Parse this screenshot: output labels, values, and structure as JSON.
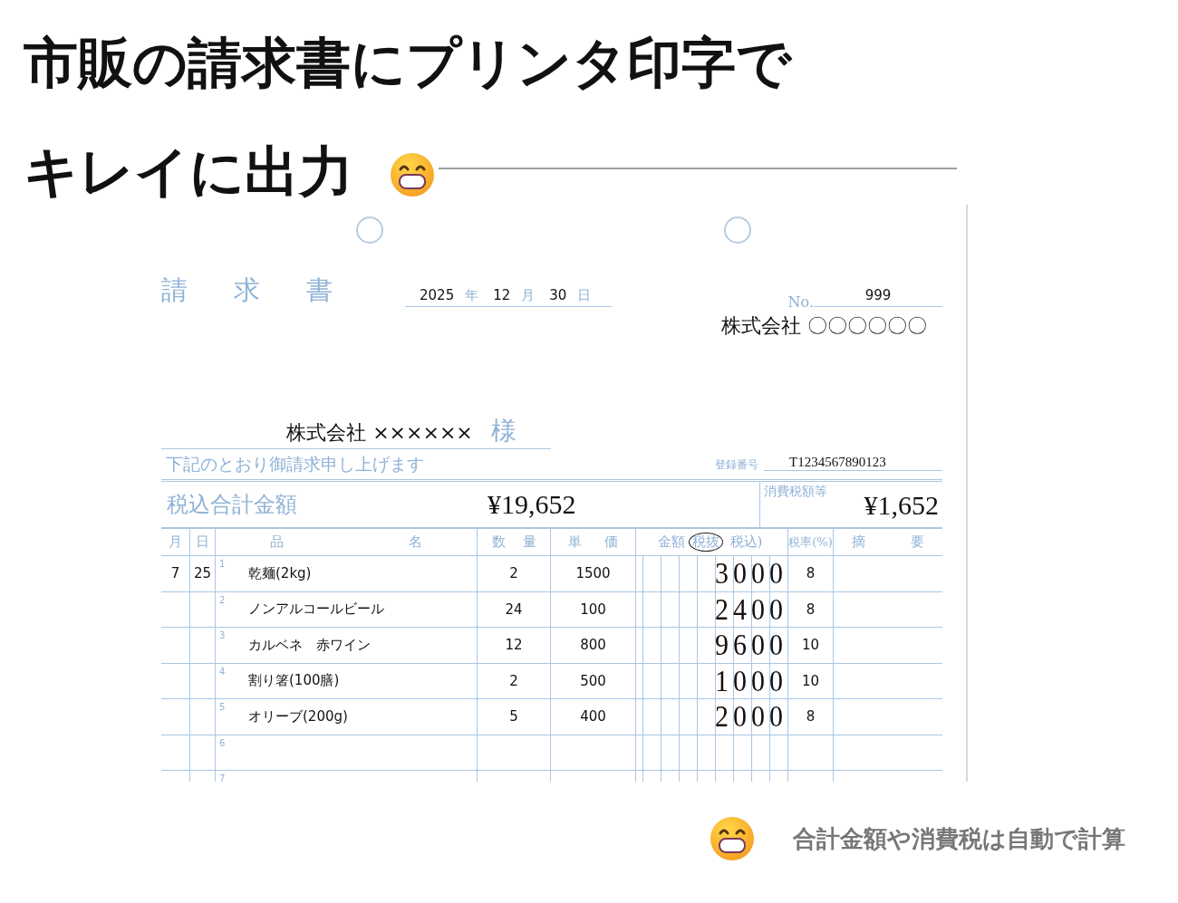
{
  "heading": {
    "lines": [
      "市販の請求書にプリンタ印字で",
      "キレイに出力"
    ]
  },
  "invoice": {
    "title": "請求書",
    "date": {
      "year": "2025",
      "year_label": "年",
      "month": "12",
      "month_label": "月",
      "day": "30",
      "day_label": "日"
    },
    "number_label": "No.",
    "number": "999",
    "issuer": "株式会社 〇〇〇〇〇〇",
    "recipient": "株式会社 ××××××",
    "honorific": "様",
    "message": "下記のとおり御請求申し上げます",
    "registration_label": "登録番号",
    "registration": "T1234567890123",
    "total_label": "税込合計金額",
    "total": "¥19,652",
    "tax_label": "消費税額等",
    "tax": "¥1,652",
    "columns": {
      "month": "月",
      "day": "日",
      "item": [
        "品",
        "名"
      ],
      "quantity": [
        "数",
        "量"
      ],
      "price": [
        "単",
        "価"
      ],
      "amount": "金額",
      "amount_options": [
        {
          "label": "税抜",
          "selected": true
        },
        {
          "label": "税込)",
          "selected": false
        }
      ],
      "rate": "税率(%)",
      "note": [
        "摘",
        "要"
      ]
    },
    "rows": [
      {
        "no": "1",
        "month": "7",
        "day": "25",
        "item": "乾麺(2kg)",
        "quantity": "2",
        "price": "1500",
        "amount": "3000",
        "rate": "8"
      },
      {
        "no": "2",
        "item": "ノンアルコールビール",
        "quantity": "24",
        "price": "100",
        "amount": "2400",
        "rate": "8"
      },
      {
        "no": "3",
        "item": "カルベネ　赤ワイン",
        "quantity": "12",
        "price": "800",
        "amount": "9600",
        "rate": "10"
      },
      {
        "no": "4",
        "item": "割り箸(100膳)",
        "quantity": "2",
        "price": "500",
        "amount": "1000",
        "rate": "10"
      },
      {
        "no": "5",
        "item": "オリーブ(200g)",
        "quantity": "5",
        "price": "400",
        "amount": "2000",
        "rate": "8"
      },
      {
        "no": "6"
      },
      {
        "no": "7"
      }
    ]
  },
  "caption": "合計金額や消費税は自動で計算"
}
